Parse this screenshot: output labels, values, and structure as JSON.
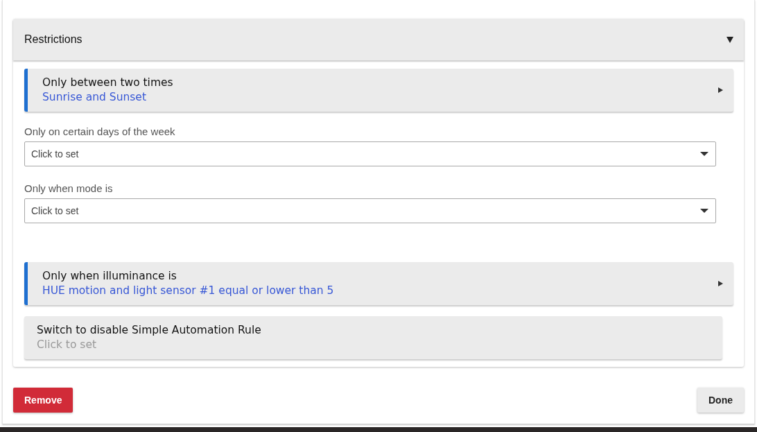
{
  "section": {
    "title": "Restrictions",
    "expanded": true,
    "items": [
      {
        "kind": "summary",
        "title": "Only between two times",
        "value": "Sunrise and Sunset"
      },
      {
        "kind": "select",
        "label": "Only on certain days of the week",
        "placeholder": "Click to set"
      },
      {
        "kind": "select",
        "label": "Only when mode is",
        "placeholder": "Click to set"
      },
      {
        "kind": "summary",
        "title": "Only when illuminance is",
        "value": "HUE motion and light sensor #1 equal or lower than 5"
      },
      {
        "kind": "unset",
        "title": "Switch to disable Simple Automation Rule",
        "value": "Click to set"
      }
    ]
  },
  "buttons": [
    {
      "kind": "danger",
      "label": "Remove"
    },
    {
      "kind": "default",
      "label": "Done"
    }
  ]
}
